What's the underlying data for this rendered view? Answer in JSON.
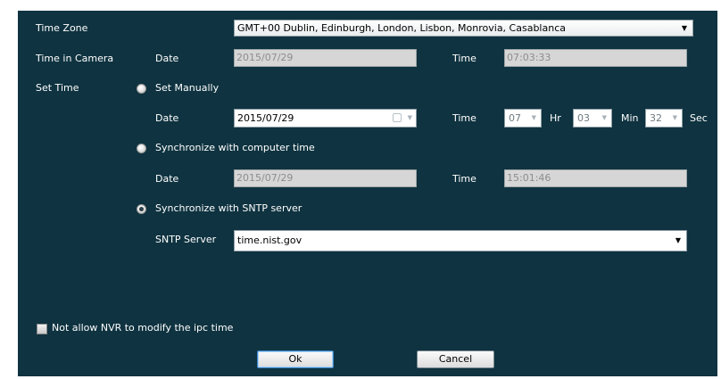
{
  "time_zone": {
    "label": "Time Zone",
    "value": "GMT+00 Dublin, Edinburgh, London, Lisbon, Monrovia, Casablanca"
  },
  "time_in_camera": {
    "label": "Time in Camera",
    "date_label": "Date",
    "date_value": "2015/07/29",
    "time_label": "Time",
    "time_value": "07:03:33"
  },
  "set_time": {
    "label": "Set Time",
    "manual": {
      "label": "Set Manually",
      "selected": false,
      "date_label": "Date",
      "date_value": "2015/07/29",
      "time_label": "Time",
      "hour": "07",
      "hour_unit": "Hr",
      "minute": "03",
      "minute_unit": "Min",
      "second": "32",
      "second_unit": "Sec"
    },
    "computer": {
      "label": "Synchronize with computer time",
      "selected": false,
      "date_label": "Date",
      "date_value": "2015/07/29",
      "time_label": "Time",
      "time_value": "15:01:46"
    },
    "sntp": {
      "label": "Synchronize with SNTP server",
      "selected": true,
      "server_label": "SNTP Server",
      "server_value": "time.nist.gov"
    }
  },
  "nvr_checkbox": {
    "label": "Not allow NVR to modify the ipc time",
    "checked": false
  },
  "buttons": {
    "ok": "Ok",
    "cancel": "Cancel"
  },
  "icons": {
    "dropdown": "▼",
    "spin": "▼"
  },
  "colors": {
    "panel_bg": "#0f3340",
    "readonly_field": "#d6d6d6",
    "focus_border": "#3a86c9"
  }
}
